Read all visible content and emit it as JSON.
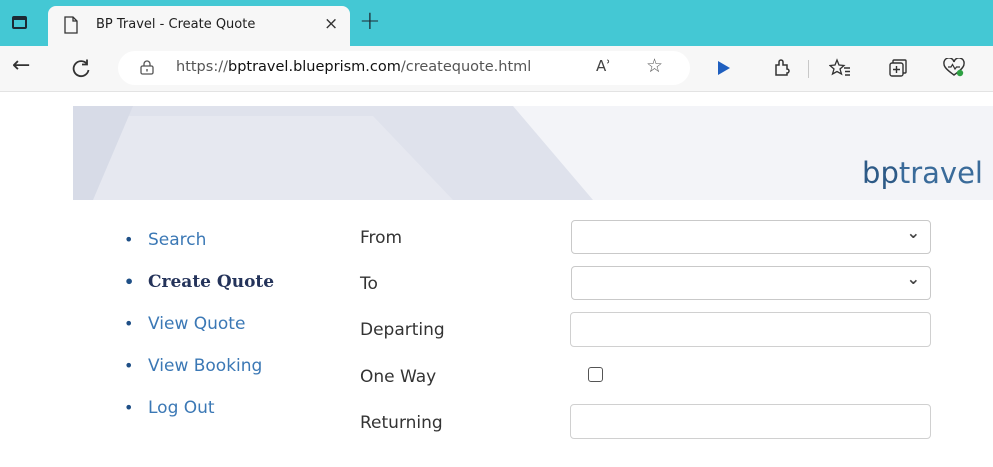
{
  "browser": {
    "tab_title": "BP Travel - Create Quote",
    "tab_close": "×",
    "new_tab": "+",
    "url_prefix": "https://",
    "url_host": "bptravel.blueprism.com",
    "url_path": "/createquote.html",
    "read_aloud": "Aʾ",
    "favorite": "☆"
  },
  "header": {
    "brand_prefix": "bp",
    "brand_suffix": "travel"
  },
  "sidebar": {
    "items": [
      {
        "label": "Search"
      },
      {
        "label": "Create Quote"
      },
      {
        "label": "View Quote"
      },
      {
        "label": "View Booking"
      },
      {
        "label": "Log Out"
      }
    ],
    "active_index": 1
  },
  "form": {
    "from_label": "From",
    "from_value": "",
    "to_label": "To",
    "to_value": "",
    "departing_label": "Departing",
    "departing_value": "",
    "one_way_label": "One Way",
    "one_way_checked": false,
    "returning_label": "Returning",
    "returning_value": ""
  },
  "colors": {
    "tabstrip": "#44c8d4",
    "brand": "#3a6b9a",
    "nav_link": "#3b78b5",
    "nav_active": "#24335a"
  }
}
